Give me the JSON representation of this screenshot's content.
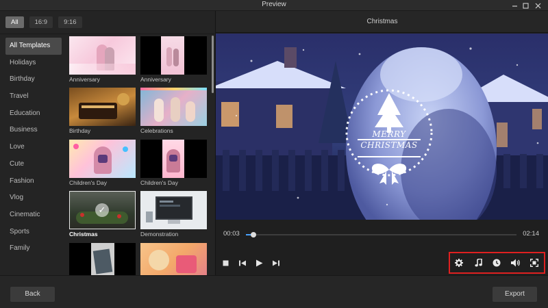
{
  "window": {
    "title": "Preview",
    "controls": [
      "minimize-icon",
      "maximize-icon",
      "close-icon"
    ]
  },
  "filters": [
    {
      "label": "All",
      "active": true
    },
    {
      "label": "16:9",
      "active": false
    },
    {
      "label": "9:16",
      "active": false
    }
  ],
  "categories": [
    {
      "label": "All Templates",
      "active": true
    },
    {
      "label": "Holidays"
    },
    {
      "label": "Birthday"
    },
    {
      "label": "Travel"
    },
    {
      "label": "Education"
    },
    {
      "label": "Business"
    },
    {
      "label": "Love"
    },
    {
      "label": "Cute"
    },
    {
      "label": "Fashion"
    },
    {
      "label": "Vlog"
    },
    {
      "label": "Cinematic"
    },
    {
      "label": "Sports"
    },
    {
      "label": "Family"
    }
  ],
  "templates": [
    {
      "label": "Anniversary"
    },
    {
      "label": "Anniversary"
    },
    {
      "label": "Birthday"
    },
    {
      "label": "Celebrations"
    },
    {
      "label": "Children's Day"
    },
    {
      "label": "Children's Day"
    },
    {
      "label": "Christmas",
      "selected": true
    },
    {
      "label": "Demonstration"
    },
    {
      "label": ""
    },
    {
      "label": ""
    }
  ],
  "preview": {
    "title": "Christmas",
    "video_text": {
      "line1": "MERRY",
      "line2": "CHRISTMAS"
    },
    "current_time": "00:03",
    "total_time": "02:14",
    "progress": 0.028
  },
  "playback_controls": [
    "stop-icon",
    "previous-frame-icon",
    "play-icon",
    "next-frame-icon"
  ],
  "tools": [
    "settings-gear-icon",
    "music-note-icon",
    "clock-icon",
    "volume-icon",
    "fullscreen-icon"
  ],
  "colors": {
    "accent": "#4aa3ff",
    "highlight_box": "#e02020",
    "background": "#232323"
  },
  "footer": {
    "back_label": "Back",
    "export_label": "Export"
  }
}
